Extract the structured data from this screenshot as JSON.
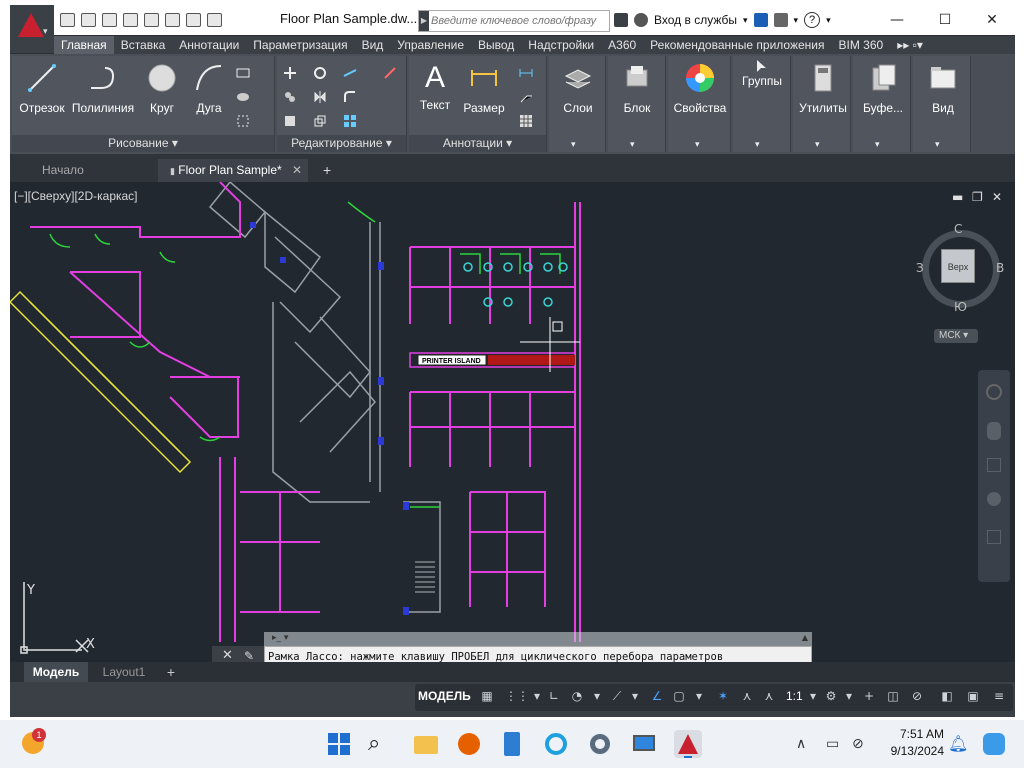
{
  "window": {
    "title": "Floor Plan Sample.dw...",
    "search_placeholder": "Введите ключевое слово/фразу",
    "signin": "Вход в службы",
    "help": "?"
  },
  "ribbon_tabs": [
    "Главная",
    "Вставка",
    "Аннотации",
    "Параметризация",
    "Вид",
    "Управление",
    "Вывод",
    "Надстройки",
    "A360",
    "Рекомендованные приложения",
    "BIM 360"
  ],
  "ribbon": {
    "draw": {
      "label": "Рисование",
      "line": "Отрезок",
      "polyline": "Полилиния",
      "circle": "Круг",
      "arc": "Дуга"
    },
    "modify": {
      "label": "Редактирование"
    },
    "annotation": {
      "label": "Аннотации",
      "text": "Текст",
      "dimension": "Размер"
    },
    "layers": "Слои",
    "block": "Блок",
    "properties": "Свойства",
    "groups": "Группы",
    "utilities": "Утилиты",
    "clipboard": "Буфе...",
    "view": "Вид"
  },
  "file_tabs": {
    "start": "Начало",
    "current": "Floor Plan Sample*"
  },
  "viewport": {
    "label": "[−][Сверху][2D-каркас]",
    "viewcube": {
      "n": "С",
      "s": "Ю",
      "w": "З",
      "e": "В",
      "top": "Верх",
      "ucs": "МСК"
    },
    "printer_label": "PRINTER ISLAND",
    "y_axis": "Y",
    "x_axis": "X"
  },
  "command_line": {
    "text": "Рамка Лассо: нажмите клавишу ПРОБЕЛ для циклического перебора параметров"
  },
  "layout_tabs": [
    "Модель",
    "Layout1"
  ],
  "statusbar": {
    "model": "МОДЕЛЬ",
    "scale": "1:1"
  },
  "taskbar": {
    "time": "7:51 AM",
    "date": "9/13/2024",
    "notif_count": "1"
  }
}
